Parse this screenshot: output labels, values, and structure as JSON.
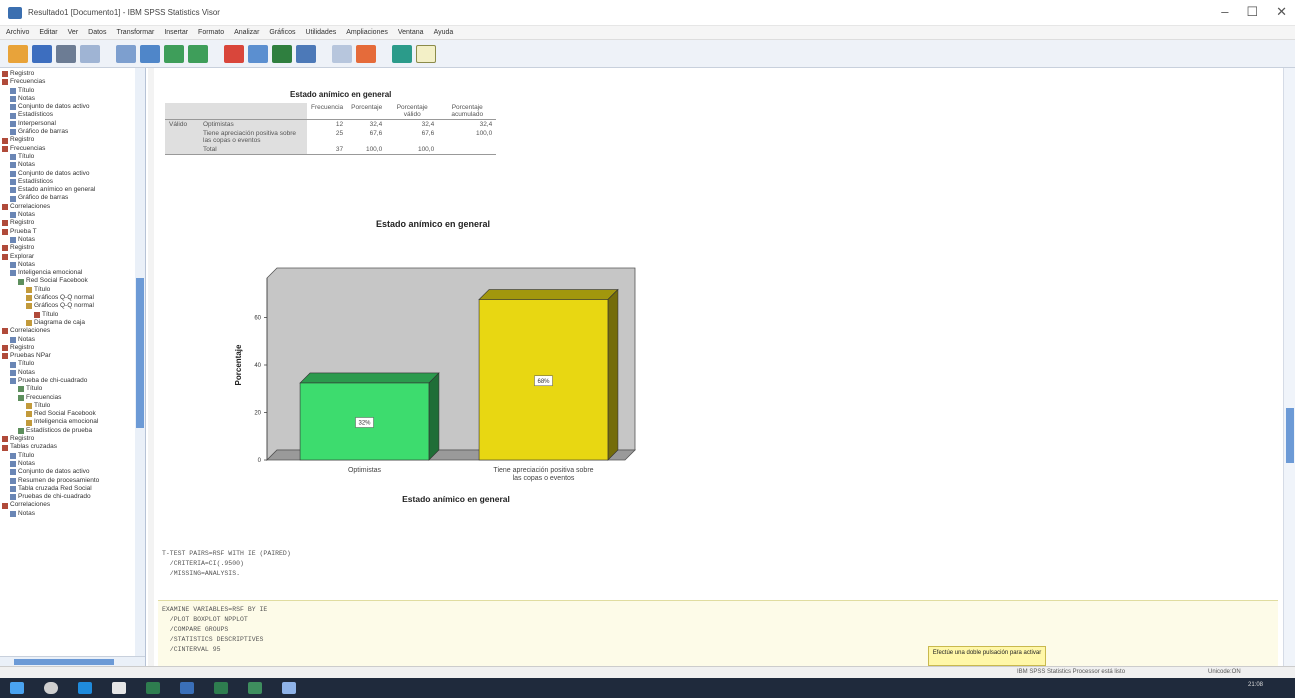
{
  "window": {
    "title": "Resultado1 [Documento1] - IBM SPSS Statistics Visor",
    "controls": [
      "–",
      "☐",
      "✕"
    ]
  },
  "menu": [
    "Archivo",
    "Editar",
    "Ver",
    "Datos",
    "Transformar",
    "Insertar",
    "Formato",
    "Analizar",
    "Gráficos",
    "Utilidades",
    "Ampliaciones",
    "Ventana",
    "Ayuda"
  ],
  "nav_tree": [
    {
      "label": "Registro",
      "level": 0
    },
    {
      "label": "Frecuencias",
      "level": 0
    },
    {
      "label": "Título",
      "level": 1
    },
    {
      "label": "Notas",
      "level": 1
    },
    {
      "label": "Conjunto de datos activo",
      "level": 1
    },
    {
      "label": "Estadísticos",
      "level": 1
    },
    {
      "label": "Interpersonal",
      "level": 1
    },
    {
      "label": "Gráfico de barras",
      "level": 1
    },
    {
      "label": "Registro",
      "level": 0
    },
    {
      "label": "Frecuencias",
      "level": 0
    },
    {
      "label": "Título",
      "level": 1
    },
    {
      "label": "Notas",
      "level": 1
    },
    {
      "label": "Conjunto de datos activo",
      "level": 1
    },
    {
      "label": "Estadísticos",
      "level": 1
    },
    {
      "label": "Estado anímico en general",
      "level": 1
    },
    {
      "label": "Gráfico de barras",
      "level": 1
    },
    {
      "label": "Correlaciones",
      "level": 0
    },
    {
      "label": "Notas",
      "level": 1
    },
    {
      "label": "Registro",
      "level": 0
    },
    {
      "label": "Prueba T",
      "level": 0
    },
    {
      "label": "Notas",
      "level": 1
    },
    {
      "label": "Registro",
      "level": 0
    },
    {
      "label": "Explorar",
      "level": 0
    },
    {
      "label": "Notas",
      "level": 1
    },
    {
      "label": "Inteligencia emocional",
      "level": 1
    },
    {
      "label": "Red Social Facebook",
      "level": 2
    },
    {
      "label": "Título",
      "level": 3
    },
    {
      "label": "Gráficos Q-Q normal",
      "level": 3
    },
    {
      "label": "Gráficos Q-Q normal",
      "level": 3
    },
    {
      "label": "Título",
      "level": 4
    },
    {
      "label": "Diagrama de caja",
      "level": 3
    },
    {
      "label": "Correlaciones",
      "level": 0
    },
    {
      "label": "Notas",
      "level": 1
    },
    {
      "label": "Registro",
      "level": 0
    },
    {
      "label": "Pruebas NPar",
      "level": 0
    },
    {
      "label": "Título",
      "level": 1
    },
    {
      "label": "Notas",
      "level": 1
    },
    {
      "label": "Prueba de chi-cuadrado",
      "level": 1
    },
    {
      "label": "Título",
      "level": 2
    },
    {
      "label": "Frecuencias",
      "level": 2
    },
    {
      "label": "Título",
      "level": 3
    },
    {
      "label": "Red Social Facebook",
      "level": 3
    },
    {
      "label": "Inteligencia emocional",
      "level": 3
    },
    {
      "label": "Estadísticos de prueba",
      "level": 2
    },
    {
      "label": "Registro",
      "level": 0
    },
    {
      "label": "Tablas cruzadas",
      "level": 0
    },
    {
      "label": "Título",
      "level": 1
    },
    {
      "label": "Notas",
      "level": 1
    },
    {
      "label": "Conjunto de datos activo",
      "level": 1
    },
    {
      "label": "Resumen de procesamiento",
      "level": 1
    },
    {
      "label": "Tabla cruzada Red Social",
      "level": 1
    },
    {
      "label": "Pruebas de chi-cuadrado",
      "level": 1
    },
    {
      "label": "Correlaciones",
      "level": 0
    },
    {
      "label": "Notas",
      "level": 1
    }
  ],
  "freq_table": {
    "title": "Estado anímico en general",
    "headers": [
      "Frecuencia",
      "Porcentaje",
      "Porcentaje válido",
      "Porcentaje acumulado"
    ],
    "group_label": "Válido",
    "rows": [
      {
        "label": "Optimistas",
        "values": [
          "12",
          "32,4",
          "32,4",
          "32,4"
        ]
      },
      {
        "label": "Tiene apreciación positiva sobre las copas o eventos",
        "values": [
          "25",
          "67,6",
          "67,6",
          "100,0"
        ]
      },
      {
        "label": "Total",
        "values": [
          "37",
          "100,0",
          "100,0",
          ""
        ]
      }
    ]
  },
  "chart_data": {
    "type": "bar",
    "title": "Estado anímico en general",
    "xlabel": "Estado anímico en general",
    "ylabel": "Porcentaje",
    "categories": [
      "Optimistas",
      "Tiene apreciación positiva sobre las copas o eventos"
    ],
    "values": [
      32.43,
      67.57
    ],
    "data_labels": [
      "32%",
      "68%"
    ],
    "yticks": [
      0,
      20,
      40,
      60
    ],
    "ylim": [
      0,
      80
    ],
    "colors": [
      "#3ddc6e",
      "#e8d712"
    ],
    "background": "#c6c6c6"
  },
  "syntax_blocks": [
    [
      "T-TEST PAIRS=RSF WITH IE (PAIRED)",
      "  /CRITERIA=CI(.9500)",
      "  /MISSING=ANALYSIS."
    ],
    [
      "EXAMINE VARIABLES=RSF BY IE",
      "  /PLOT BOXPLOT NPPLOT",
      "  /COMPARE GROUPS",
      "  /STATISTICS DESCRIPTIVES",
      "  /CINTERVAL 95"
    ]
  ],
  "tooltip": "Efectúe una doble pulsación para activar",
  "status": {
    "left": "IBM SPSS Statistics Processor está listo",
    "right": "Unicode:ON"
  },
  "tray_time": "21:08"
}
